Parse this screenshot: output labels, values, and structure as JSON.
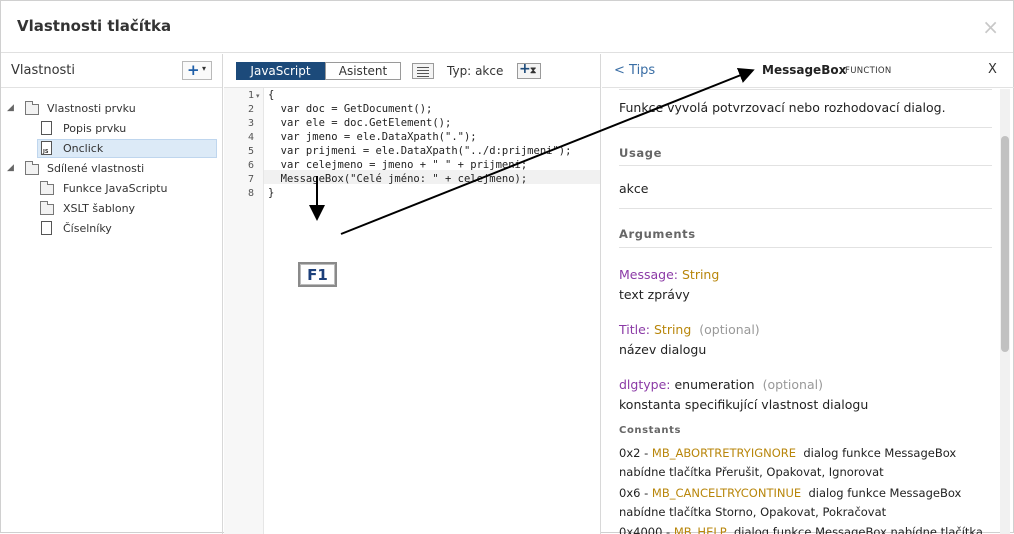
{
  "dialog": {
    "title": "Vlastnosti tlačítka",
    "close_glyph": "×"
  },
  "left": {
    "header": "Vlastnosti",
    "add_glyph": "+",
    "add_caret": "▾",
    "tree": [
      {
        "label": "Vlastnosti prvku",
        "icon": "folder-icon",
        "expanded": true
      },
      {
        "label": "Popis prvku",
        "icon": "document-icon"
      },
      {
        "label": "Onclick",
        "icon": "js-document-icon",
        "selected": true,
        "icon_text": "JS"
      },
      {
        "label": "Sdílené vlastnosti",
        "icon": "folder-icon",
        "expanded": true
      },
      {
        "label": "Funkce JavaScriptu",
        "icon": "folder-icon"
      },
      {
        "label": "XSLT šablony",
        "icon": "folder-icon"
      },
      {
        "label": "Číselníky",
        "icon": "document-icon"
      }
    ]
  },
  "middle": {
    "tabs": [
      {
        "label": "JavaScript",
        "active": true
      },
      {
        "label": "Asistent",
        "active": false
      }
    ],
    "type_label": "Typ:",
    "type_value": "akce",
    "type_btn_plus": "+",
    "type_btn_side": "⧗",
    "line_numbers": [
      "1",
      "2",
      "3",
      "4",
      "5",
      "6",
      "7",
      "8"
    ],
    "fold_glyph": "▾",
    "code": [
      "{",
      "  var doc = GetDocument();",
      "  var ele = doc.GetElement();",
      "  var jmeno = ele.DataXpath(\".\");",
      "  var prijmeni = ele.DataXpath(\"../d:prijmeni\");",
      "  var celejmeno = jmeno + \" \" + prijmeni;",
      "  MessageBox(\"Celé jméno: \" + celejmeno);",
      "}"
    ],
    "highlighted_line": 7,
    "key_hint": "F1"
  },
  "right": {
    "back_link": "< Tips",
    "function_name": "MessageBox",
    "function_kind": "FUNCTION",
    "close_glyph": "X",
    "description": "Funkce vyvolá potvrzovací nebo rozhodovací dialog.",
    "usage_heading": "Usage",
    "usage_text": "akce",
    "arguments_heading": "Arguments",
    "arguments": [
      {
        "name": "Message",
        "type": "String",
        "optional": "",
        "desc": "text zprávy"
      },
      {
        "name": "Title",
        "type": "String",
        "optional": "(optional)",
        "desc": "název dialogu"
      },
      {
        "name": "dlgtype",
        "type": "enumeration",
        "optional": "(optional)",
        "desc": "konstanta specifikující vlastnost dialogu"
      }
    ],
    "constants_heading": "Constants",
    "constants": [
      {
        "value": "0x2",
        "name": "MB_ABORTRETRYIGNORE",
        "line1": "dialog funkce MessageBox",
        "line2": "nabídne tlačítka Přerušit, Opakovat, Ignorovat"
      },
      {
        "value": "0x6",
        "name": "MB_CANCELTRYCONTINUE",
        "line1": "dialog funkce MessageBox",
        "line2": "nabídne tlačítka Storno, Opakovat, Pokračovat"
      },
      {
        "value": "0x4000",
        "name": "MB_HELP",
        "line1": "dialog funkce MessageBox nabídne tlačítka",
        "line2": ""
      }
    ],
    "sep": " - ",
    "colon": ": "
  }
}
